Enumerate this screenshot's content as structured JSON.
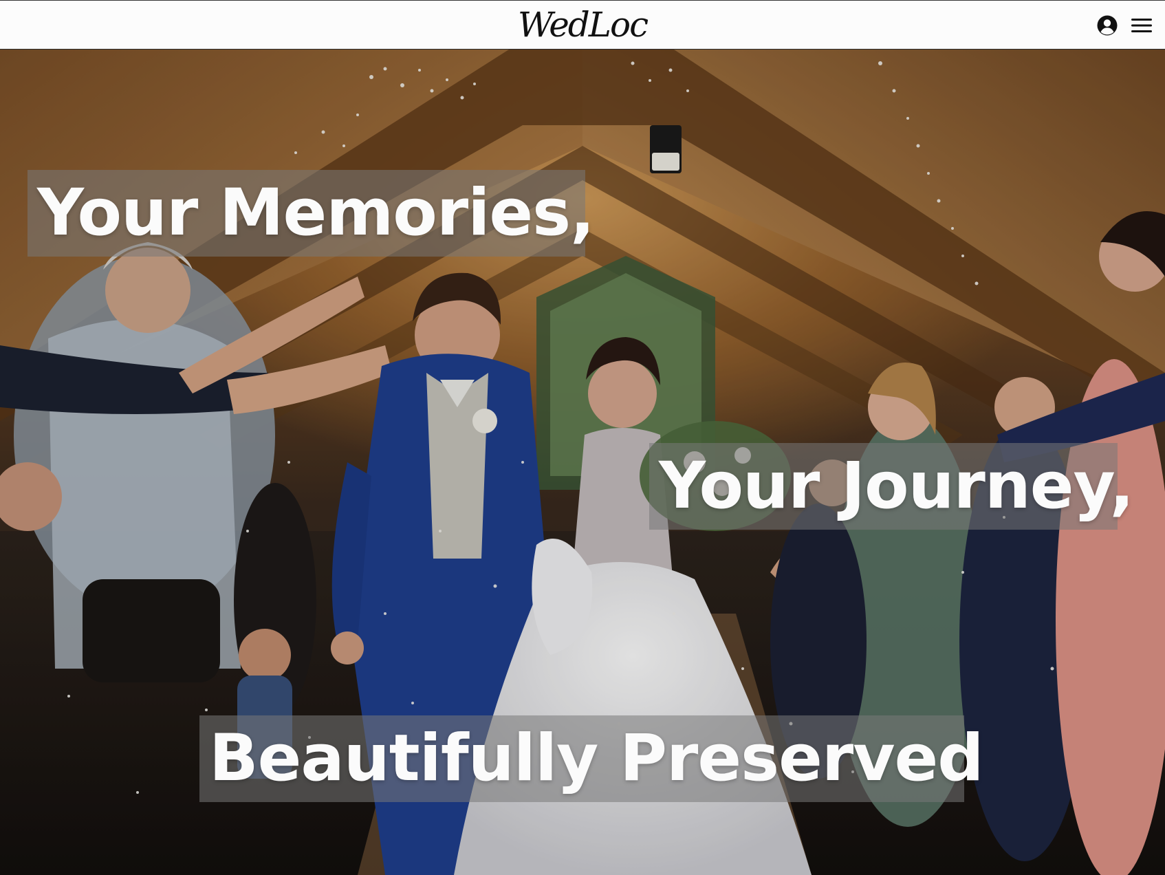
{
  "navbar": {
    "logo_text": "WedLoc",
    "account_icon": "account-circle-icon",
    "menu_icon": "hamburger-menu-icon"
  },
  "hero": {
    "image_subject": "wedding-photo",
    "headline_1": "Your Memories,",
    "headline_2": "Your Journey,",
    "headline_3": "Beautifully Preserved"
  },
  "colors": {
    "navbar_bg": "#fcfcfc",
    "headline_text": "#fbfbfb",
    "headline_box": "rgba(120,120,120,0.55)"
  }
}
